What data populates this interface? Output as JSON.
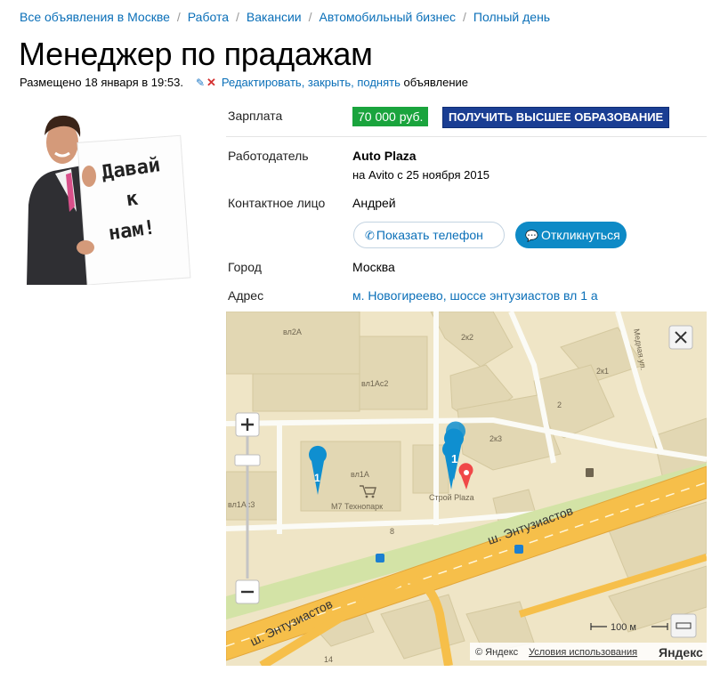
{
  "breadcrumbs": [
    "Все объявления в Москве",
    "Работа",
    "Вакансии",
    "Автомобильный бизнес",
    "Полный день"
  ],
  "title": "Менеджер по прадажам",
  "meta": {
    "posted": "Размещено 18 января в 19:53.",
    "edit_link": "Редактировать, закрыть, поднять",
    "suffix": "объявление"
  },
  "photo": {
    "sign_text": [
      "Давай",
      "к",
      "нам!"
    ]
  },
  "details": {
    "salary_label": "Зарплата",
    "salary_value": "70 000 руб.",
    "edu_banner": "ПОЛУЧИТЬ ВЫСШЕЕ ОБРАЗОВАНИЕ",
    "employer_label": "Работодатель",
    "employer_name": "Auto Plaza",
    "employer_since": "на Avito с 25 ноября 2015",
    "contact_label": "Контактное лицо",
    "contact_name": "Андрей",
    "phone_button": "Показать телефон",
    "respond_button": "Откликнуться",
    "city_label": "Город",
    "city_value": "Москва",
    "address_label": "Адрес",
    "address_value": "м. Новогиреево, шоссе энтузиастов вл 1 а"
  },
  "map": {
    "labels": {
      "vl2a": "вл2А",
      "2k2": "2к2",
      "vl1ac2": "вл1Ас2",
      "mednaya": "Медная ул.",
      "2k1": "2к1",
      "n2": "2",
      "2k3": "2к3",
      "vl1a": "вл1А",
      "vl1ac3": "вл1Ас3",
      "m7": "М7 Технопарк",
      "stroy": "Строй Plaza",
      "n8": "8",
      "road1": "ш. Энтузиастов",
      "road2": "ш. Энтузиастов",
      "n14": "14"
    },
    "pin_labels": [
      "1",
      "1"
    ],
    "scale": "100 м",
    "copyright": "© Яндекс",
    "terms": "Условия использования",
    "brand": "Яндекс"
  },
  "colors": {
    "link": "#0a6fb8",
    "salary_bg": "#1aa43d",
    "edu_bg": "#1a3e93",
    "respond_bg": "#0e8ac6",
    "road": "#f6bf4a",
    "pin": "#0f8fd0",
    "target_pin": "#f04848"
  }
}
